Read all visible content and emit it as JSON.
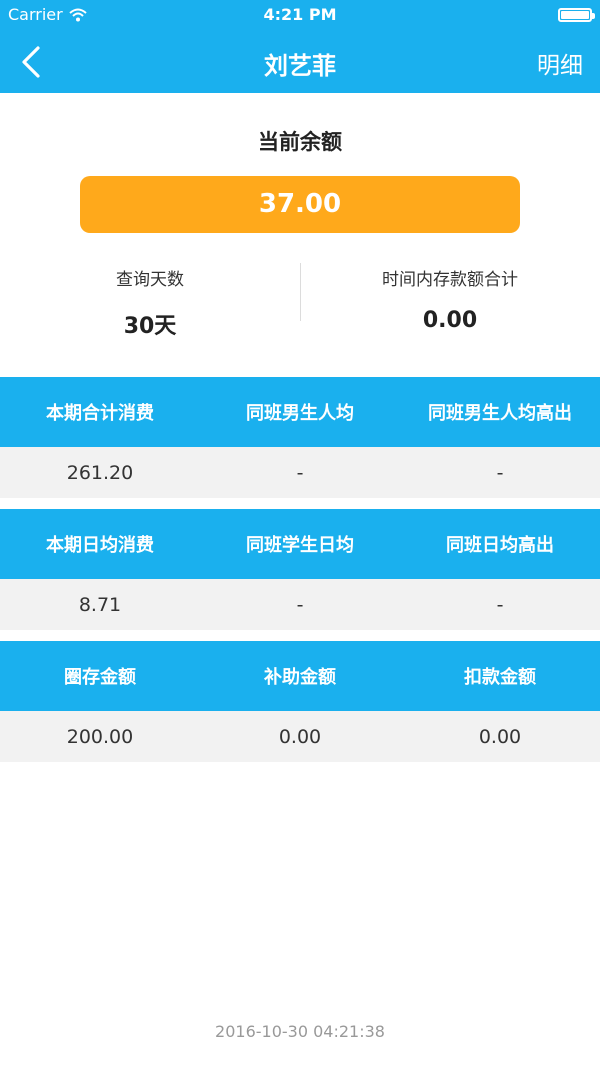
{
  "status_bar": {
    "carrier": "Carrier",
    "time": "4:21 PM"
  },
  "nav": {
    "title": "刘艺菲",
    "detail_label": "明细",
    "back_icon": "chevron-left-icon"
  },
  "balance": {
    "title": "当前余额",
    "value": "37.00"
  },
  "stats": [
    {
      "label": "查询天数",
      "value": "30天"
    },
    {
      "label": "时间内存款额合计",
      "value": "0.00"
    }
  ],
  "sections": [
    {
      "headers": [
        "本期合计消费",
        "同班男生人均",
        "同班男生人均高出"
      ],
      "values": [
        "261.20",
        "-",
        "-"
      ]
    },
    {
      "headers": [
        "本期日均消费",
        "同班学生日均",
        "同班日均高出"
      ],
      "values": [
        "8.71",
        "-",
        "-"
      ]
    },
    {
      "headers": [
        "圈存金额",
        "补助金额",
        "扣款金额"
      ],
      "values": [
        "200.00",
        "0.00",
        "0.00"
      ]
    }
  ],
  "footer": {
    "timestamp": "2016-10-30 04:21:38"
  },
  "colors": {
    "primary": "#1ab0ee",
    "balance": "#ffa91b",
    "row_bg": "#f2f2f2"
  }
}
